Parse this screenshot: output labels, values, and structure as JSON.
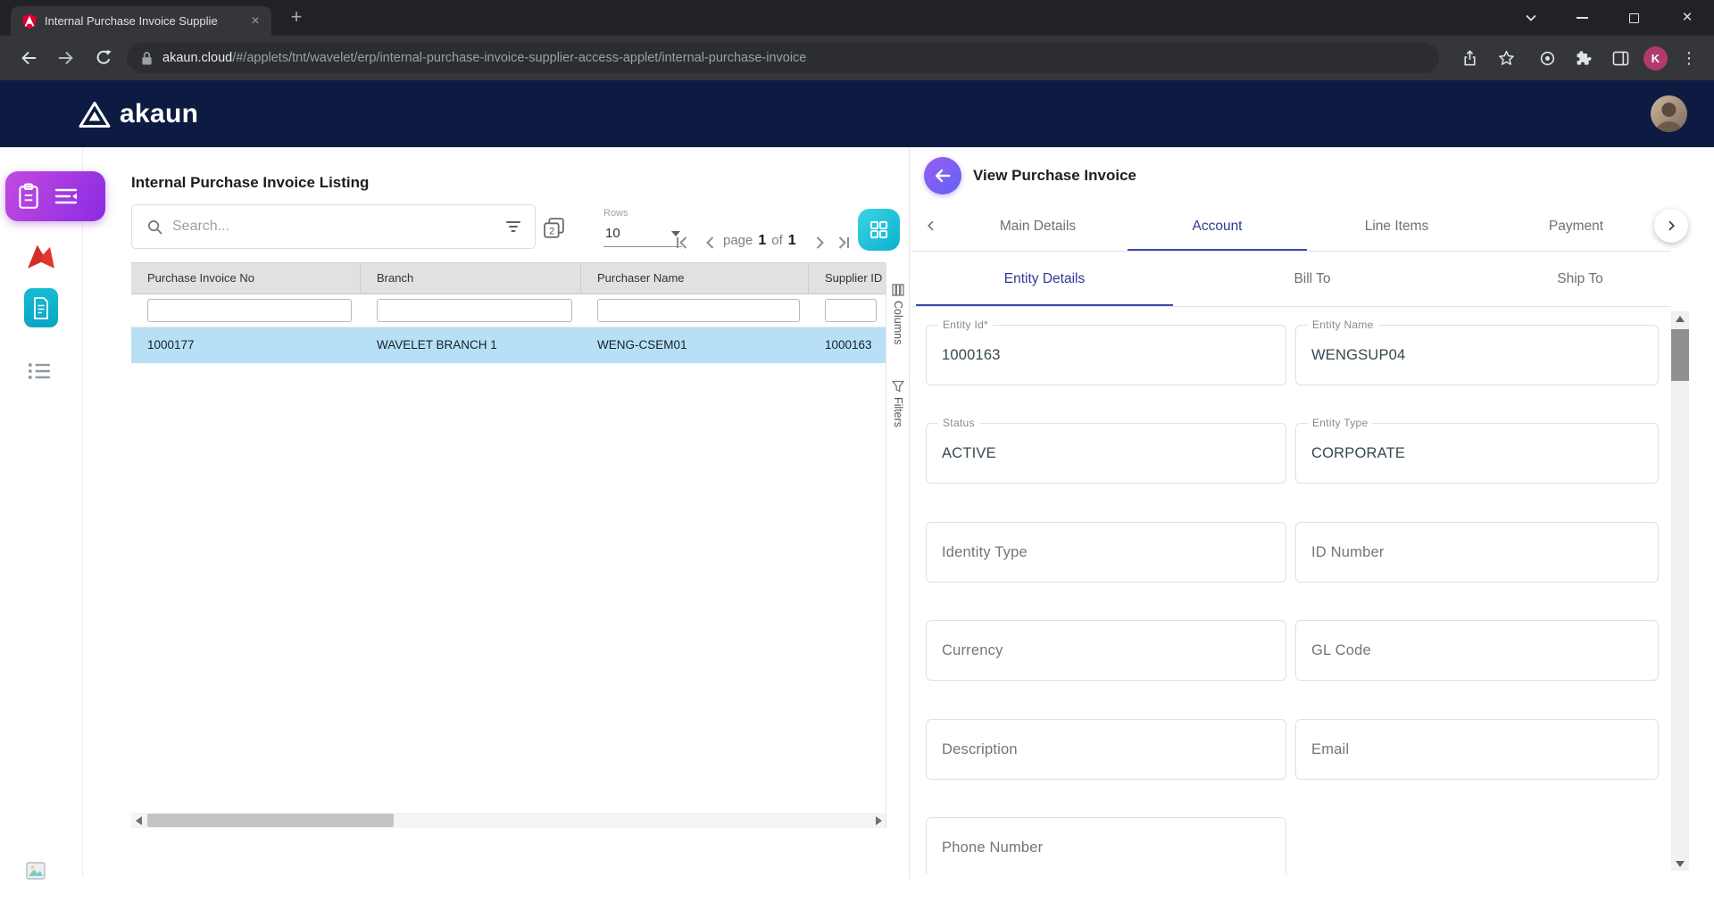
{
  "browser": {
    "tab_title": "Internal Purchase Invoice Supplie",
    "url_domain": "akaun.cloud",
    "url_path": "/#/applets/tnt/wavelet/erp/internal-purchase-invoice-supplier-access-applet/internal-purchase-invoice",
    "profile_initial": "K"
  },
  "icons": {
    "close": "×",
    "new_tab": "+",
    "kebab": "⋮"
  },
  "app_header": {
    "logo_text": "akaun"
  },
  "listing": {
    "title": "Internal Purchase Invoice Listing",
    "search_placeholder": "Search...",
    "rows_label": "Rows",
    "rows_per_page": "10",
    "pagination": {
      "page_word": "page",
      "current": "1",
      "of_word": "of",
      "total": "1"
    },
    "columns": [
      "Purchase Invoice No",
      "Branch",
      "Purchaser Name",
      "Supplier ID"
    ],
    "rows": [
      [
        "1000177",
        "WAVELET BRANCH 1",
        "WENG-CSEM01",
        "1000163"
      ]
    ],
    "side_tools": [
      "Columns",
      "Filters"
    ]
  },
  "detail": {
    "title": "View Purchase Invoice",
    "tabs": [
      "Main Details",
      "Account",
      "Line Items",
      "Payment"
    ],
    "active_tab": "Account",
    "sub_tabs": [
      "Entity Details",
      "Bill To",
      "Ship To"
    ],
    "active_sub_tab": "Entity Details",
    "fields": [
      {
        "label": "Entity Id*",
        "value": "1000163"
      },
      {
        "label": "Entity Name",
        "value": "WENGSUP04"
      },
      {
        "label": "Status",
        "value": "ACTIVE"
      },
      {
        "label": "Entity Type",
        "value": "CORPORATE"
      },
      {
        "label": "Identity Type",
        "value": ""
      },
      {
        "label": "ID Number",
        "value": ""
      },
      {
        "label": "Currency",
        "value": ""
      },
      {
        "label": "GL Code",
        "value": ""
      },
      {
        "label": "Description",
        "value": ""
      },
      {
        "label": "Email",
        "value": ""
      },
      {
        "label": "Phone Number",
        "value": ""
      }
    ]
  },
  "colors": {
    "accent_indigo": "#3949ab",
    "teal_button": "#0db0cf",
    "purple_start": "#c44ae0",
    "purple_end": "#8a2be2",
    "selected_row": "#b7e0f6",
    "header_navy": "#0d1b42"
  }
}
